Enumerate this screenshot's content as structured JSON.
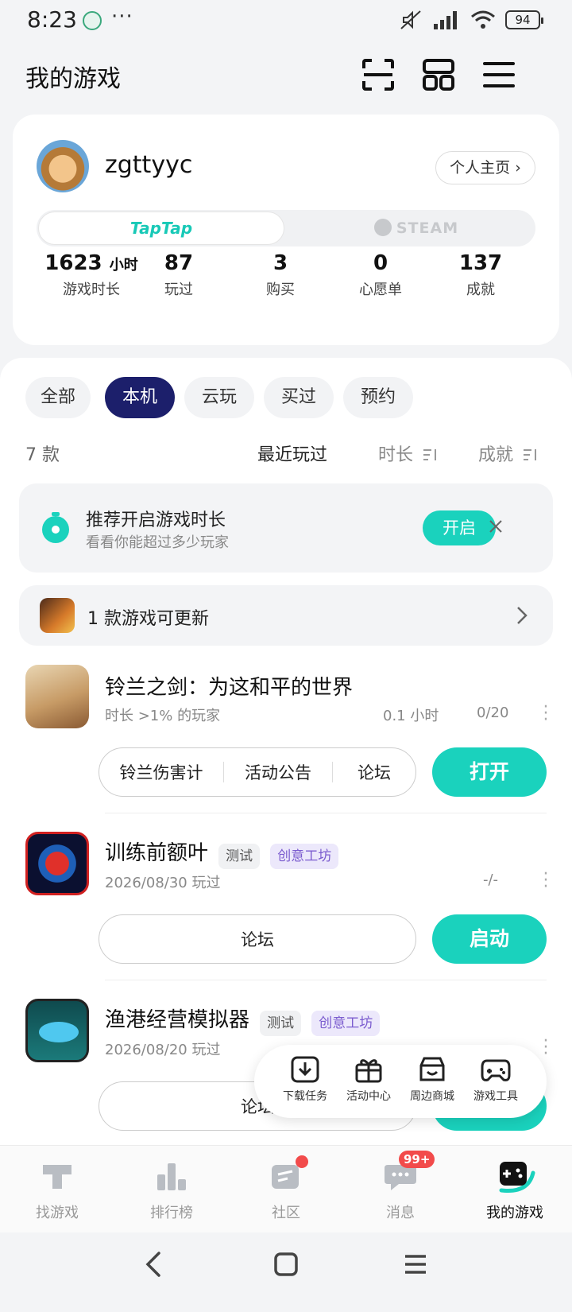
{
  "status_bar": {
    "time": "8:23",
    "dots": "···",
    "battery": "94"
  },
  "header": {
    "title": "我的游戏"
  },
  "profile": {
    "username": "zgttyyc",
    "homepage_label": "个人主页 ›",
    "platforms": {
      "taptap": "TapTap",
      "steam": "STEAM"
    },
    "stats": [
      {
        "value": "1623",
        "unit": "小时",
        "label": "游戏时长"
      },
      {
        "value": "87",
        "label": "玩过"
      },
      {
        "value": "3",
        "label": "购买"
      },
      {
        "value": "0",
        "label": "心愿单"
      },
      {
        "value": "137",
        "label": "成就"
      }
    ]
  },
  "filters": {
    "chips": [
      "全部",
      "本机",
      "云玩",
      "买过",
      "预约"
    ],
    "active": "本机"
  },
  "list_meta": {
    "count": "7 款",
    "sort_recent": "最近玩过",
    "sort_duration": "时长",
    "sort_achievement": "成就"
  },
  "tip": {
    "title": "推荐开启游戏时长",
    "subtitle": "看看你能超过多少玩家",
    "button": "开启"
  },
  "update": {
    "text": "1 款游戏可更新"
  },
  "games": [
    {
      "title": "铃兰之剑：为这和平的世界",
      "subtitle": "时长 >1% 的玩家",
      "hours": "0.1 小时",
      "achievements": "0/20",
      "links": [
        "铃兰伤害计",
        "活动公告",
        "论坛"
      ],
      "action": "打开"
    },
    {
      "title": "训练前额叶",
      "tags": [
        "测试",
        "创意工坊"
      ],
      "subtitle": "2026/08/30 玩过",
      "achievements": "-/-",
      "links": [
        "论坛"
      ],
      "action": "启动"
    },
    {
      "title": "渔港经营模拟器",
      "tags": [
        "测试",
        "创意工坊"
      ],
      "subtitle": "2026/08/20 玩过",
      "links": [
        "论坛"
      ],
      "action": "启动"
    }
  ],
  "floating_menu": [
    "下载任务",
    "活动中心",
    "周边商城",
    "游戏工具"
  ],
  "bottom_nav": {
    "items": [
      "找游戏",
      "排行榜",
      "社区",
      "消息",
      "我的游戏"
    ],
    "active": "我的游戏",
    "message_badge": "99+"
  },
  "colors": {
    "accent": "#1ad2bd",
    "chip_active": "#1c1f6b",
    "tag_creative": "#7b5ccf"
  }
}
